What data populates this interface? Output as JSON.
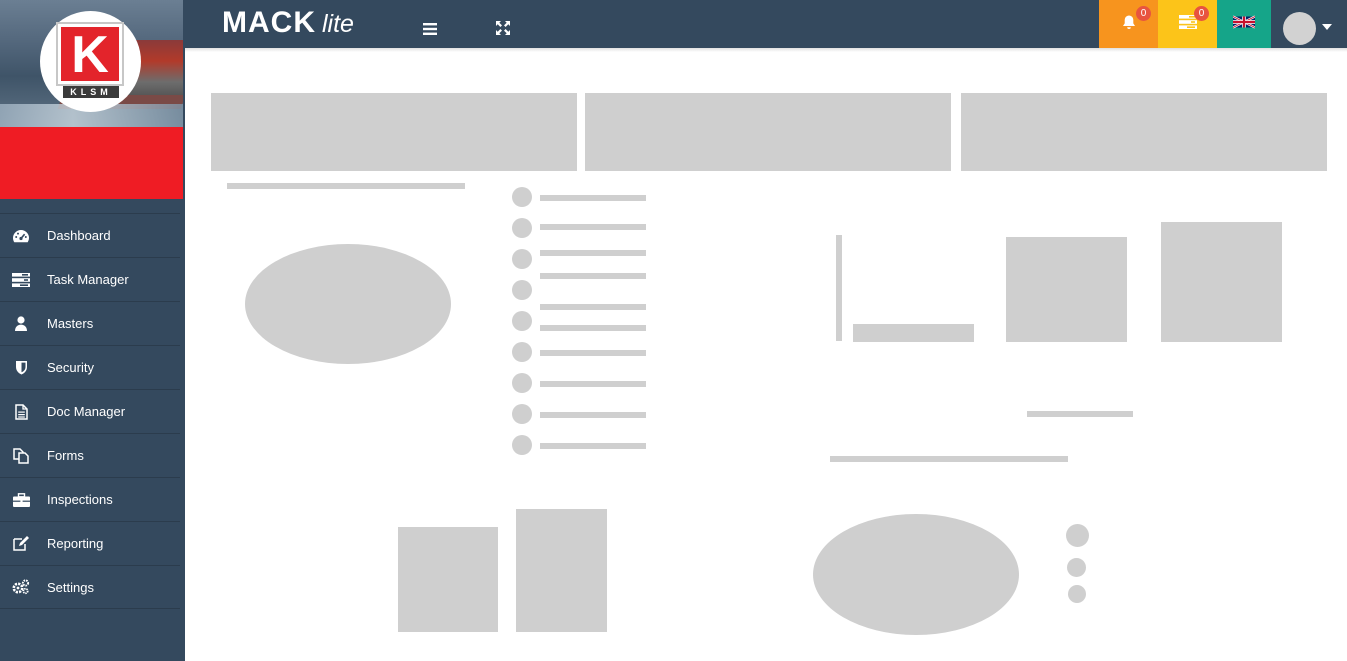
{
  "brand": {
    "logo_letter": "K",
    "logo_text": "KLSM"
  },
  "app": {
    "name_main": "MACK",
    "name_sub": "lite"
  },
  "topbar": {
    "notifications_count": "0",
    "messages_count": "0",
    "language_icon": "uk-flag-icon",
    "colors": {
      "bar": "#34495e",
      "notifications": "#f7941e",
      "messages": "#fcc419",
      "language": "#15a589",
      "badge": "#e8543f"
    }
  },
  "sidebar": {
    "colors": {
      "background": "#34495e",
      "banner": "#ef1c24"
    },
    "items": [
      {
        "label": "Dashboard",
        "icon": "speedometer-icon"
      },
      {
        "label": "Task Manager",
        "icon": "tasks-icon"
      },
      {
        "label": "Masters",
        "icon": "user-icon"
      },
      {
        "label": "Security",
        "icon": "shield-icon"
      },
      {
        "label": "Doc Manager",
        "icon": "document-icon"
      },
      {
        "label": "Forms",
        "icon": "copy-icon"
      },
      {
        "label": "Inspections",
        "icon": "briefcase-icon"
      },
      {
        "label": "Reporting",
        "icon": "edit-icon"
      },
      {
        "label": "Settings",
        "icon": "gears-icon"
      }
    ]
  },
  "content": {
    "state": "loading-skeleton",
    "placeholder_color": "#cfcfcf"
  }
}
